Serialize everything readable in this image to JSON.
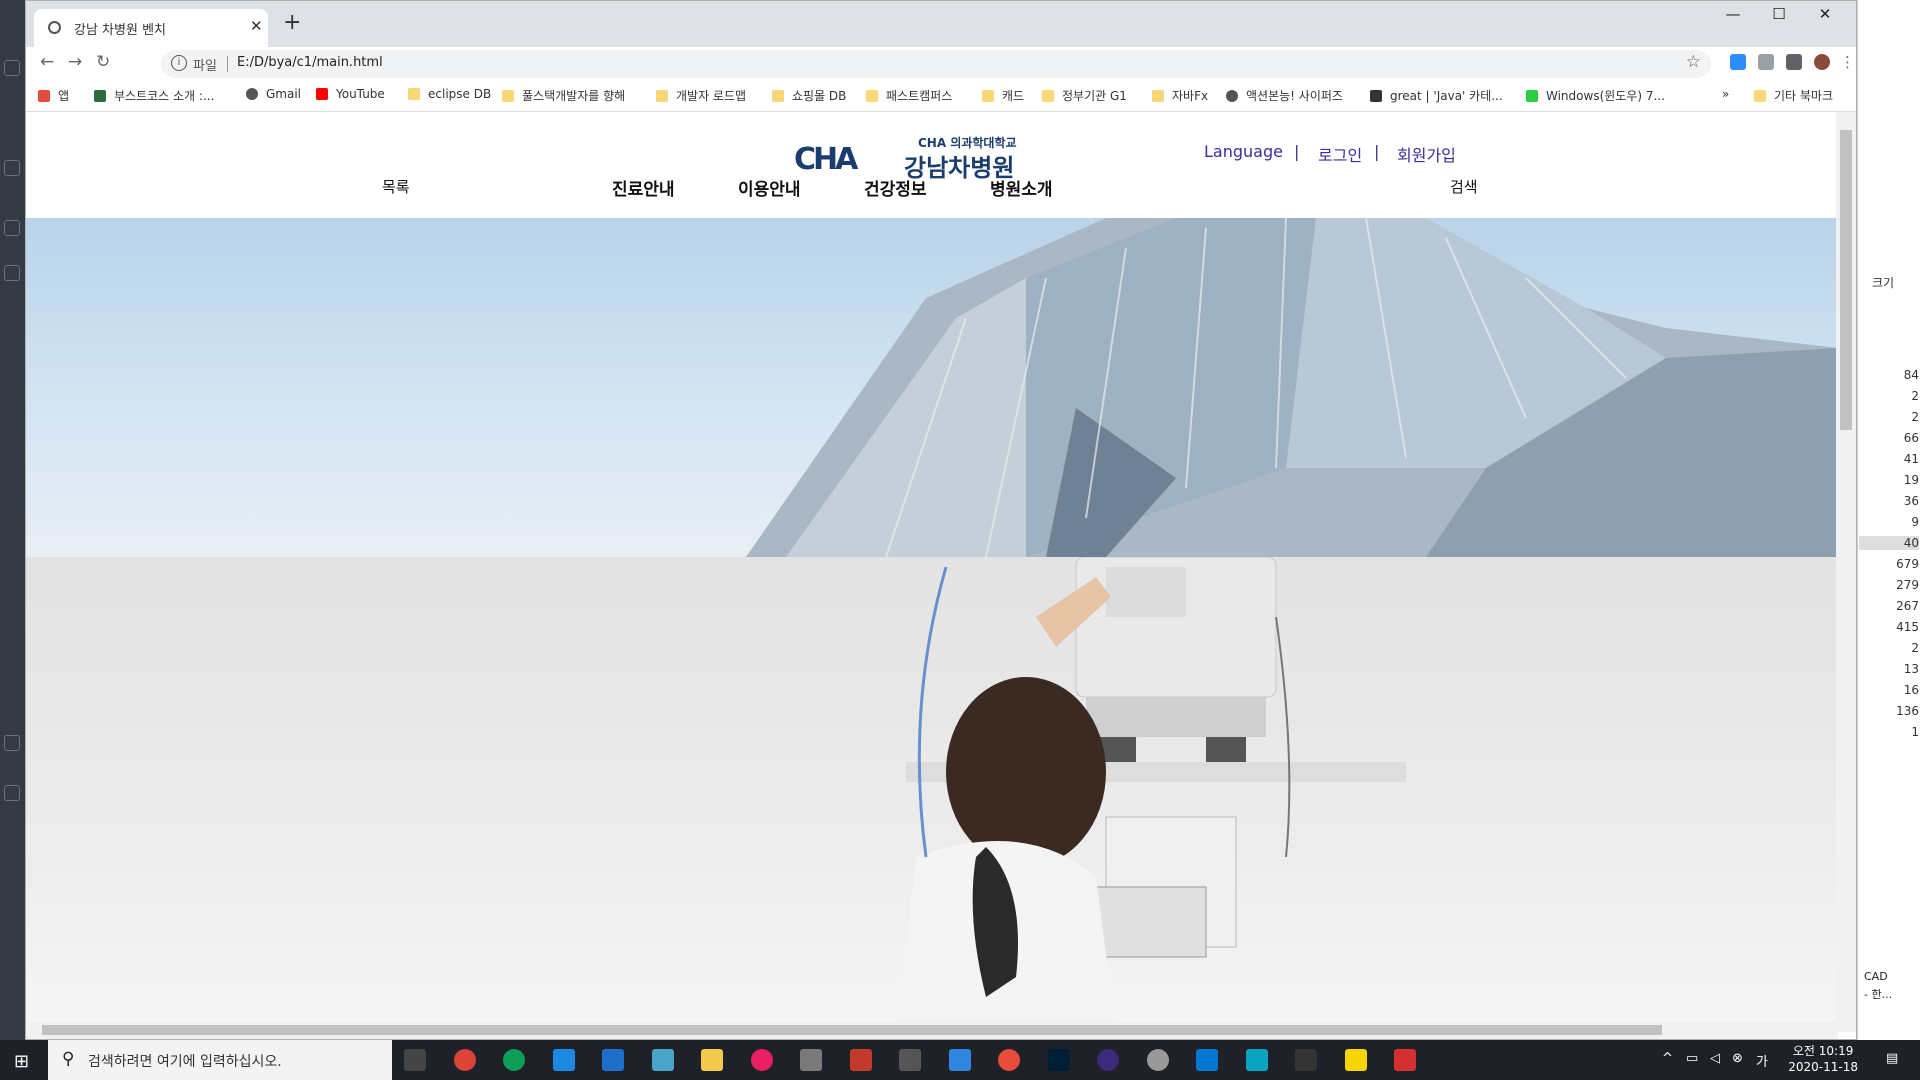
{
  "browser": {
    "tab_title": "강남 차병원 벤치",
    "new_tab_symbol": "+",
    "tab_close": "✕",
    "window_controls": [
      "—",
      "☐",
      "✕"
    ],
    "address_label": "파일",
    "address_url": "E:/D/bya/c1/main.html"
  },
  "bookmarks": [
    {
      "label": "앱",
      "color": "#e24c3c"
    },
    {
      "label": "부스트코스 소개 :...",
      "color": "#2d6a3e"
    },
    {
      "label": "Gmail",
      "color": "#555555"
    },
    {
      "label": "YouTube",
      "color": "#ff0000"
    },
    {
      "label": "eclipse DB",
      "color": "#f8d775"
    },
    {
      "label": "풀스택개발자를 향해",
      "color": "#f8d775"
    },
    {
      "label": "개발자 로드맵",
      "color": "#f8d775"
    },
    {
      "label": "쇼핑몰 DB",
      "color": "#f8d775"
    },
    {
      "label": "패스트캠퍼스",
      "color": "#f8d775"
    },
    {
      "label": "캐드",
      "color": "#f8d775"
    },
    {
      "label": "정부기관 G1",
      "color": "#f8d775"
    },
    {
      "label": "자바Fx",
      "color": "#f8d775"
    },
    {
      "label": "액션본능! 사이퍼즈",
      "color": "#555555"
    },
    {
      "label": "great | 'Java' 카테...",
      "color": "#333333"
    },
    {
      "label": "Windows(윈도우) 7...",
      "color": "#2ecc40"
    }
  ],
  "bookmarks_more": "»",
  "bookmarks_other": "기타 북마크",
  "site": {
    "logo_sub": "CHA 의과학대학교",
    "logo_mark": "CHA",
    "logo_name": "강남차병원",
    "top_links": [
      "Language",
      "로그인",
      "회원가입"
    ],
    "top_sep": "|",
    "side_left": "목록",
    "main_menu": [
      "진료안내",
      "이용안내",
      "건강정보",
      "병원소개"
    ],
    "side_right": "검색"
  },
  "right_app": {
    "label": "크기",
    "numbers": [
      "84",
      "2",
      "2",
      "66",
      "41",
      "19",
      "36",
      "9",
      "40",
      "679",
      "279",
      "267",
      "415",
      "2",
      "13",
      "16",
      "136",
      "1"
    ],
    "footer": [
      "CAD",
      "- 한..."
    ]
  },
  "taskbar": {
    "search_placeholder": "검색하려면 여기에 입력하십시오.",
    "time": "오전 10:19",
    "date": "2020-11-18"
  }
}
